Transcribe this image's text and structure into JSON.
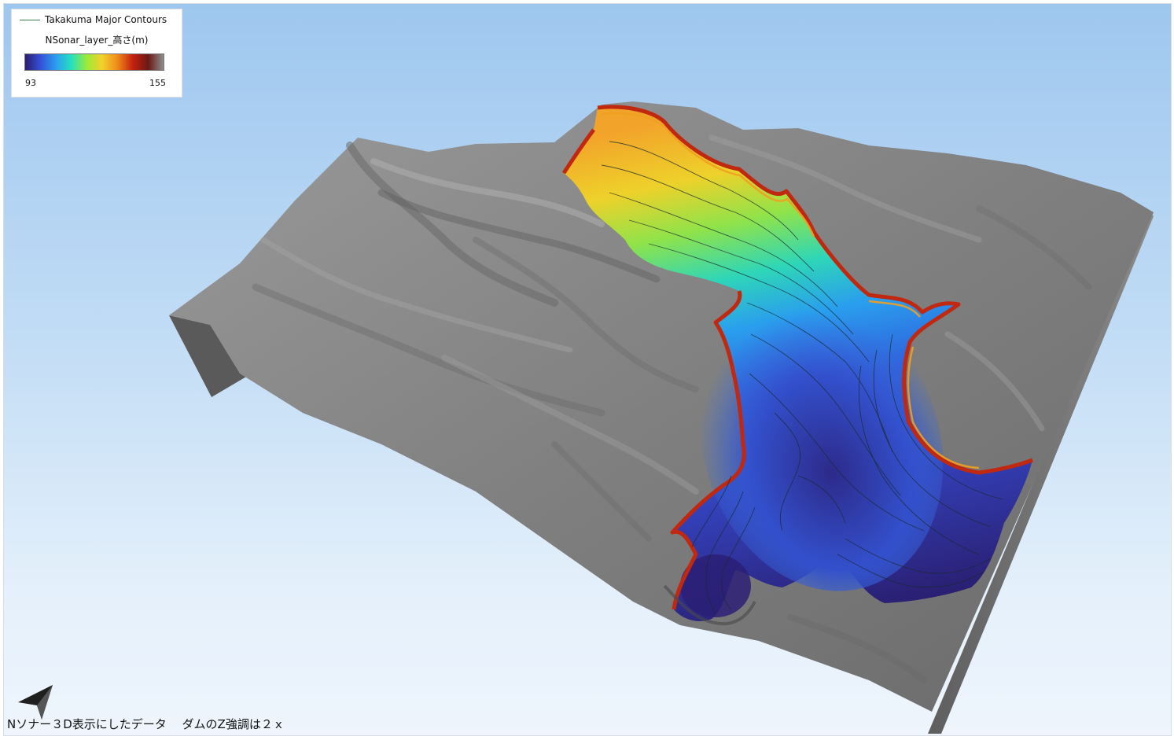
{
  "legend": {
    "line_label": "Takakuma Major Contours",
    "line_color": "#3c7a4f",
    "layer_title": "NSonar_layer_高さ(m)",
    "min_value": "93",
    "max_value": "155",
    "colormap": [
      "#2b1e6e",
      "#3450d8",
      "#2c9df0",
      "#25e0c0",
      "#9bea3a",
      "#f2d22a",
      "#f08a1a",
      "#c4200f",
      "#6a1a14",
      "#8c8c8c"
    ]
  },
  "view": {
    "terrain_color": "#7c7c7c",
    "sky_top": "#9ec7ef",
    "sky_bottom": "#eef5fc",
    "north_arrow_icon": "north-arrow-icon"
  },
  "caption": "Nソナー３D表示にしたデータ　 ダムのZ強調は２ｘ"
}
